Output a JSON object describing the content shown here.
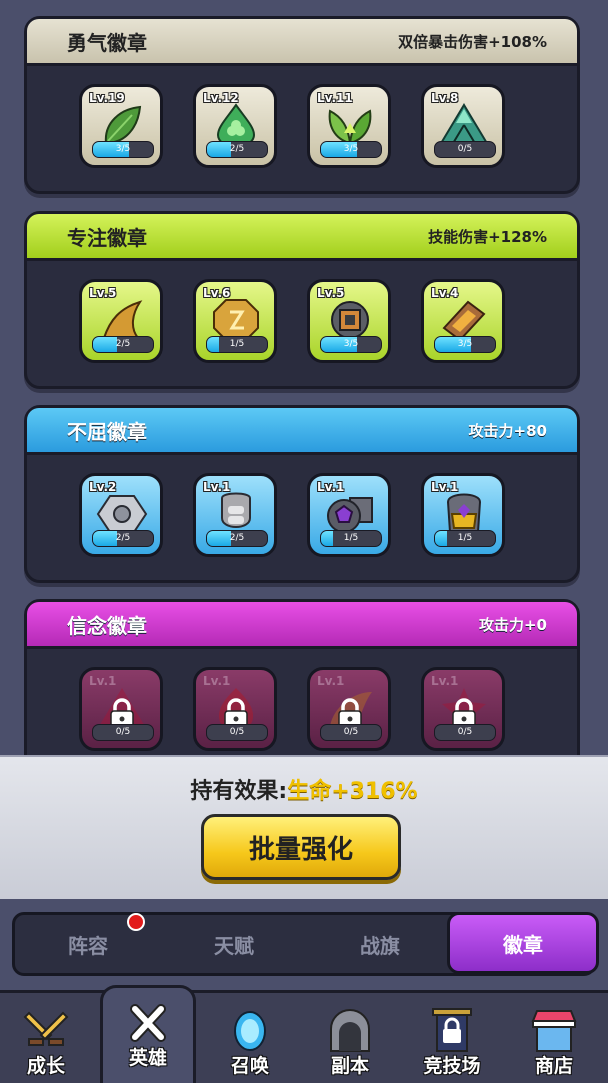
{
  "sections": [
    {
      "title": "勇气徽章",
      "effect": "双倍暴击伤害+108%",
      "badges": [
        {
          "level": "Lv.19",
          "progress": "3/5",
          "fill": 0.6
        },
        {
          "level": "Lv.12",
          "progress": "2/5",
          "fill": 0.4
        },
        {
          "level": "Lv.11",
          "progress": "3/5",
          "fill": 0.6
        },
        {
          "level": "Lv.8",
          "progress": "0/5",
          "fill": 0.0
        }
      ]
    },
    {
      "title": "专注徽章",
      "effect": "技能伤害+128%",
      "badges": [
        {
          "level": "Lv.5",
          "progress": "2/5",
          "fill": 0.4
        },
        {
          "level": "Lv.6",
          "progress": "1/5",
          "fill": 0.2
        },
        {
          "level": "Lv.5",
          "progress": "3/5",
          "fill": 0.6
        },
        {
          "level": "Lv.4",
          "progress": "3/5",
          "fill": 0.6
        }
      ]
    },
    {
      "title": "不屈徽章",
      "effect": "攻击力+80",
      "badges": [
        {
          "level": "Lv.2",
          "progress": "2/5",
          "fill": 0.4
        },
        {
          "level": "Lv.1",
          "progress": "2/5",
          "fill": 0.4
        },
        {
          "level": "Lv.1",
          "progress": "1/5",
          "fill": 0.2
        },
        {
          "level": "Lv.1",
          "progress": "1/5",
          "fill": 0.2
        }
      ]
    },
    {
      "title": "信念徽章",
      "effect": "攻击力+0",
      "badges": [
        {
          "level": "Lv.1",
          "progress": "0/5",
          "fill": 0.0
        },
        {
          "level": "Lv.1",
          "progress": "0/5",
          "fill": 0.0
        },
        {
          "level": "Lv.1",
          "progress": "0/5",
          "fill": 0.0
        },
        {
          "level": "Lv.1",
          "progress": "0/5",
          "fill": 0.0
        }
      ]
    }
  ],
  "effect_panel": {
    "label": "持有效果:",
    "value": "生命+316%",
    "button": "批量强化"
  },
  "tabs": [
    "阵容",
    "天赋",
    "战旗",
    "徽章"
  ],
  "active_tab": "徽章",
  "nav": [
    "成长",
    "英雄",
    "召唤",
    "副本",
    "竞技场",
    "商店"
  ],
  "active_nav": "英雄",
  "colors": {
    "courage": "#d8d3bf",
    "focus": "#b7dd34",
    "firm": "#3aaaea",
    "faith": "#cf3bcf",
    "button": "#f6c81b",
    "active_tab": "#a33fdd"
  }
}
